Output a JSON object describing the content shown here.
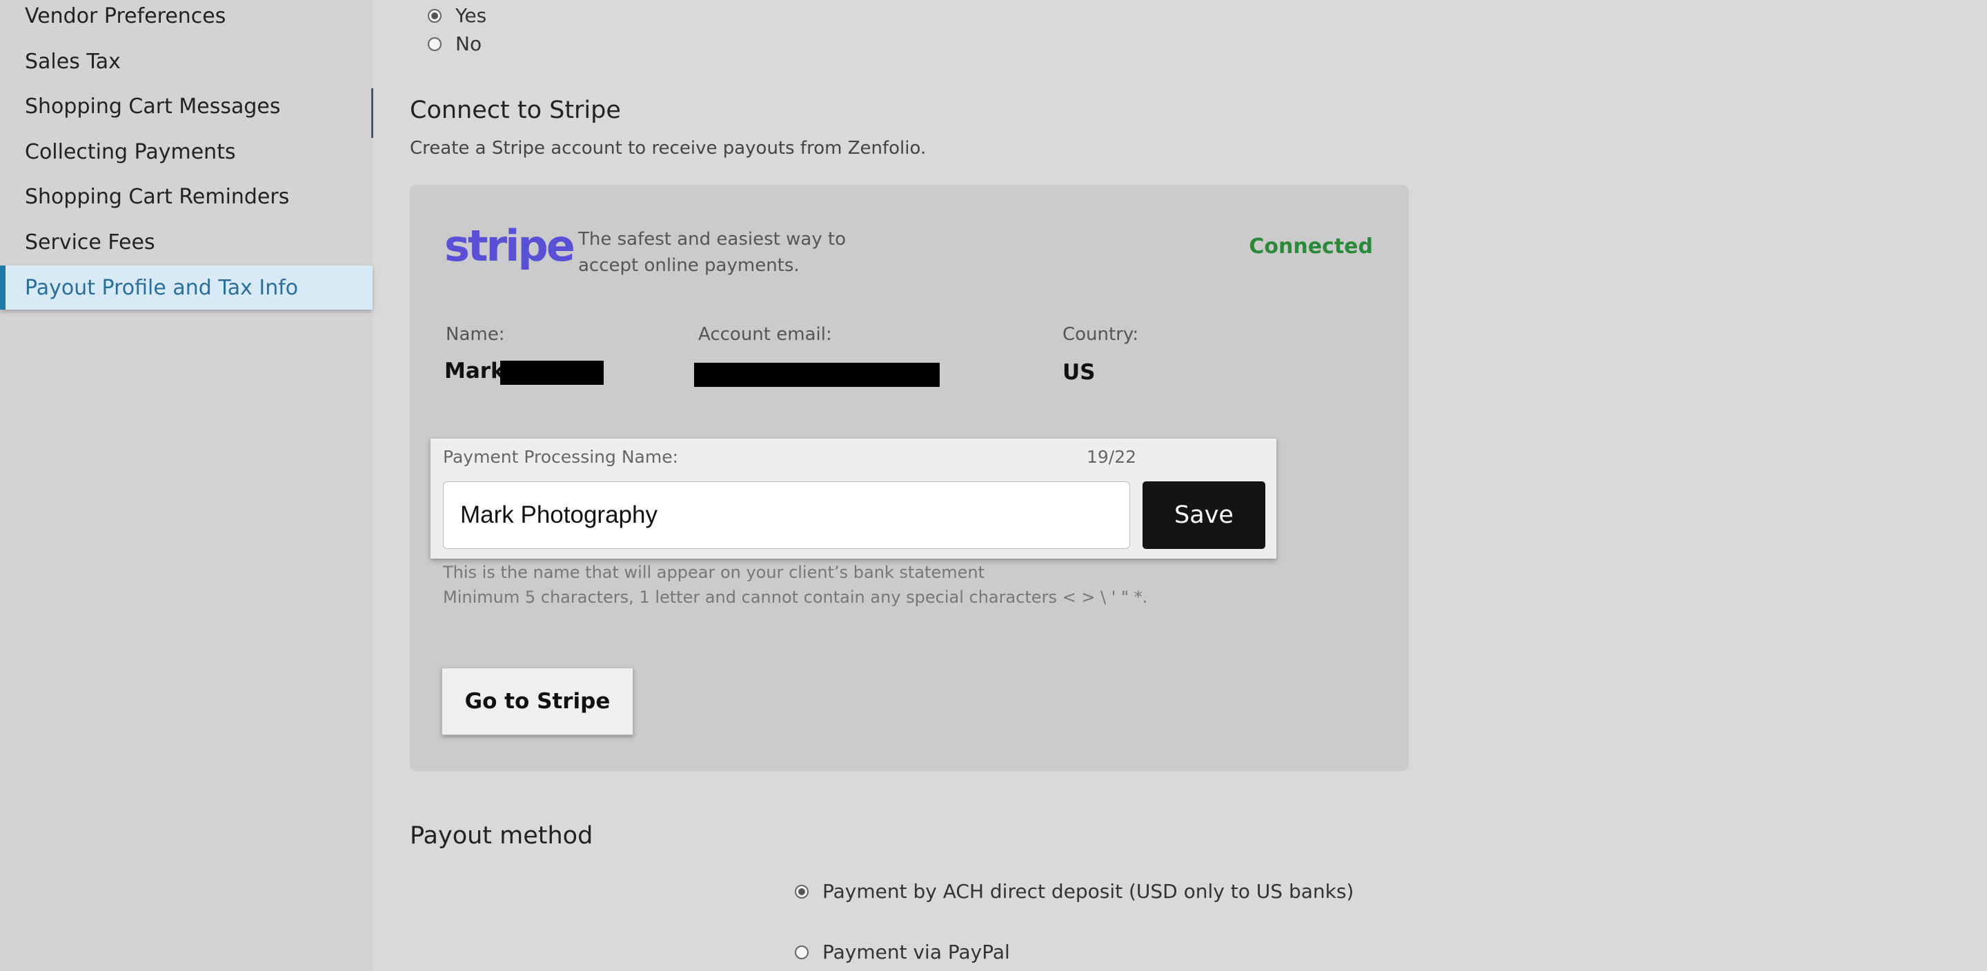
{
  "sidebar": {
    "items": [
      {
        "label": "Vendor Preferences"
      },
      {
        "label": "Sales Tax"
      },
      {
        "label": "Shopping Cart Messages"
      },
      {
        "label": "Collecting Payments"
      },
      {
        "label": "Shopping Cart Reminders"
      },
      {
        "label": "Service Fees"
      },
      {
        "label": "Payout Profile and Tax Info"
      }
    ],
    "active_index": 6
  },
  "top_radio": {
    "options": [
      {
        "label": "Yes",
        "checked": true
      },
      {
        "label": "No",
        "checked": false
      }
    ]
  },
  "stripe_section": {
    "title": "Connect to Stripe",
    "subtitle": "Create a Stripe account to receive payouts from Zenfolio.",
    "logo_text": "stripe",
    "tagline": "The safest and easiest way to accept online payments.",
    "status": "Connected",
    "name_label": "Name:",
    "name_value": "Mark",
    "email_label": "Account email:",
    "country_label": "Country:",
    "country_value": "US",
    "ppn_label": "Payment Processing Name:",
    "ppn_count": "19/22",
    "ppn_value": "Mark Photography",
    "save_label": "Save",
    "help_line1": "This is the name that will appear on your client’s bank statement",
    "help_line2": "Minimum 5 characters, 1 letter and cannot contain any special characters < > \\ ' \" *.",
    "go_button": "Go to Stripe"
  },
  "payout_section": {
    "title": "Payout method",
    "options": [
      {
        "label": "Payment by ACH direct deposit (USD only to US banks)",
        "checked": true
      },
      {
        "label": "Payment via PayPal",
        "checked": false
      }
    ]
  },
  "colors": {
    "accent": "#1f7aa6",
    "stripe_brand": "#5a50d6",
    "connected": "#2a8a3a"
  }
}
